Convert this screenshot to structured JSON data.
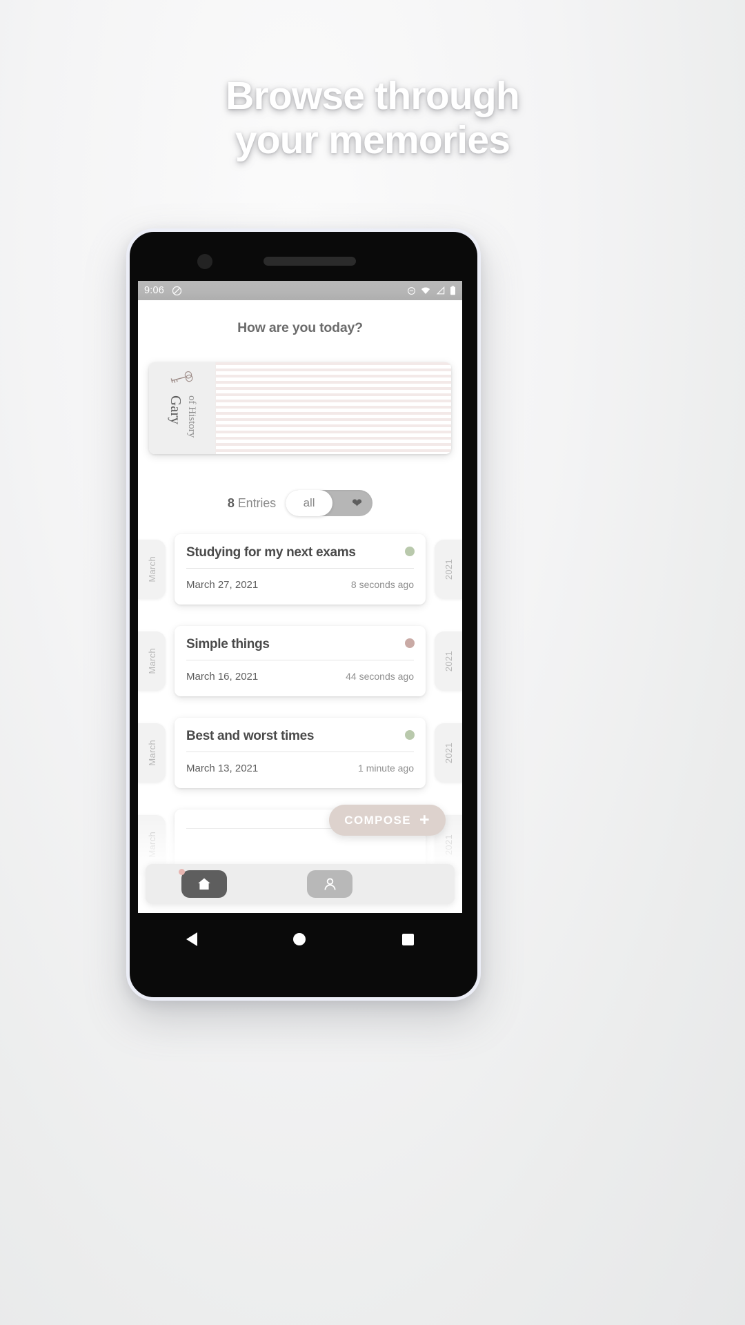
{
  "headline": "Browse through\nyour memories",
  "colors": {
    "accent": "#ddd2cd",
    "mood_green": "#b9c9ac",
    "mood_rose": "#c9aaa5",
    "nav_active": "#5e5e5e",
    "toggle_track": "#b6b6b6"
  },
  "phone": {
    "statusbar": {
      "time": "9:06",
      "left_icons": [
        "do-not-disturb-icon"
      ],
      "right_icons": [
        "mute-icon",
        "wifi-icon",
        "signal-icon",
        "battery-icon"
      ]
    },
    "android_nav": [
      "back-icon",
      "home-icon",
      "recents-icon"
    ]
  },
  "app": {
    "title": "How are you today?",
    "book": {
      "icon": "key-icon",
      "owner": "Gary",
      "subtitle": "of History"
    },
    "entries_header": {
      "count": "8",
      "count_label": "Entries",
      "toggle_selected": "all",
      "toggle_favorite_icon": "heart-icon"
    },
    "entries": [
      {
        "month": "March",
        "year": "2021",
        "title": "Studying for my next exams",
        "date": "March 27, 2021",
        "ago": "8 seconds ago",
        "mood": "#b9c9ac"
      },
      {
        "month": "March",
        "year": "2021",
        "title": "Simple things",
        "date": "March 16, 2021",
        "ago": "44 seconds ago",
        "mood": "#c9aaa5"
      },
      {
        "month": "March",
        "year": "2021",
        "title": "Best and worst times",
        "date": "March 13, 2021",
        "ago": "1 minute ago",
        "mood": "#b9c9ac"
      },
      {
        "month": "March",
        "year": "2021",
        "title": "",
        "date": "",
        "ago": "",
        "mood": "#b9c9ac"
      }
    ],
    "compose": {
      "label": "COMPOSE",
      "icon": "plus-icon"
    },
    "bottom_nav": [
      {
        "name": "home",
        "icon": "home-icon",
        "active": true,
        "badge": true
      },
      {
        "name": "profile",
        "icon": "person-icon",
        "active": false,
        "badge": false
      }
    ]
  }
}
